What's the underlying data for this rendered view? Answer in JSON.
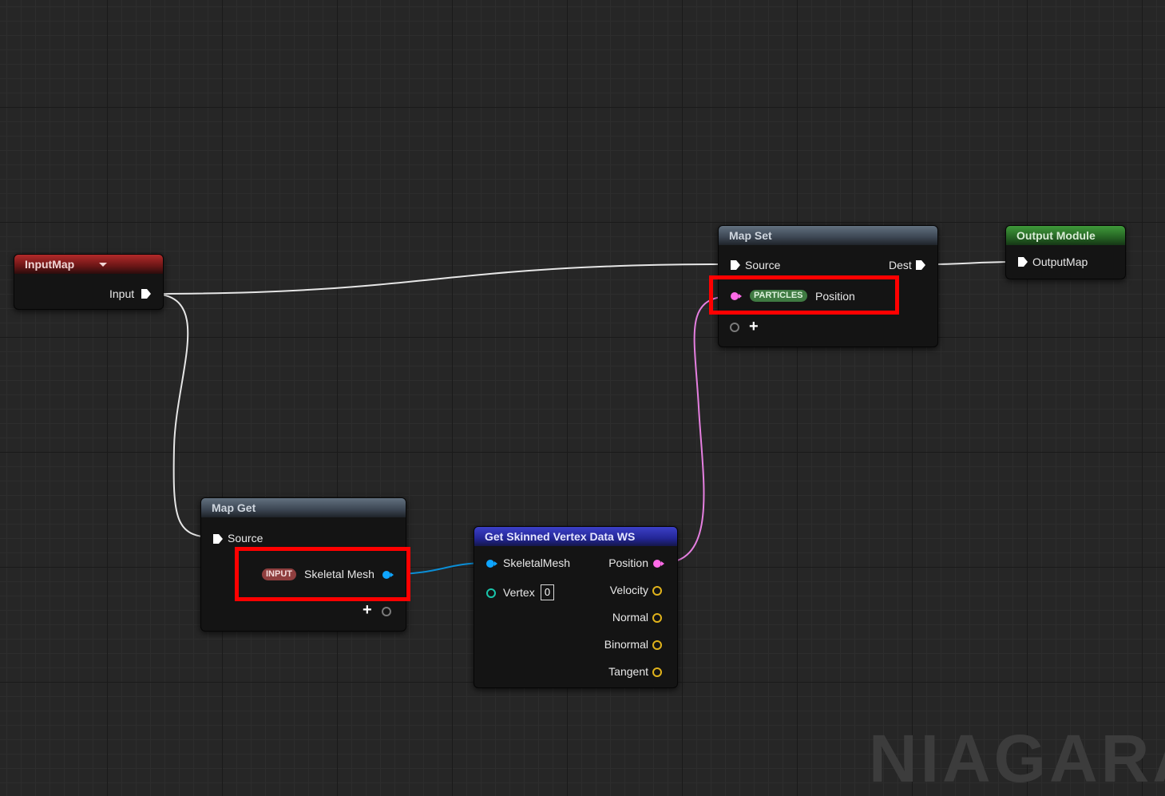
{
  "colors": {
    "exec": "#ffffff",
    "skeletal_mesh_pin": "#0ea5ff",
    "position_pin": "#ff6be8",
    "vector_pin": "#e0b21b",
    "int_pin": "#19c5ab",
    "highlight": "#ff0000",
    "input_badge": "#8f3e3e",
    "particles_badge": "#3f7a42",
    "wire_exec": "#e6e6e6",
    "wire_mesh": "#0b8ed6",
    "wire_position": "#e57fe0"
  },
  "input_map_node": {
    "title": "InputMap",
    "dropdown_icon": "triangle-down",
    "output_label": "Input"
  },
  "map_get_node": {
    "title": "Map Get",
    "source_label": "Source",
    "badge": "INPUT",
    "param_label": "Skeletal Mesh",
    "add_icon": "plus"
  },
  "skinned_node": {
    "title": "Get Skinned Vertex Data WS",
    "inputs": {
      "skeletal_mesh": "SkeletalMesh",
      "vertex": "Vertex",
      "vertex_value": "0"
    },
    "outputs": {
      "position": "Position",
      "velocity": "Velocity",
      "normal": "Normal",
      "binormal": "Binormal",
      "tangent": "Tangent"
    }
  },
  "map_set_node": {
    "title": "Map Set",
    "source_label": "Source",
    "dest_label": "Dest",
    "badge": "PARTICLES",
    "param_label": "Position",
    "add_icon": "plus"
  },
  "output_module_node": {
    "title": "Output Module",
    "input_label": "OutputMap"
  },
  "watermark": "NIAGARA"
}
